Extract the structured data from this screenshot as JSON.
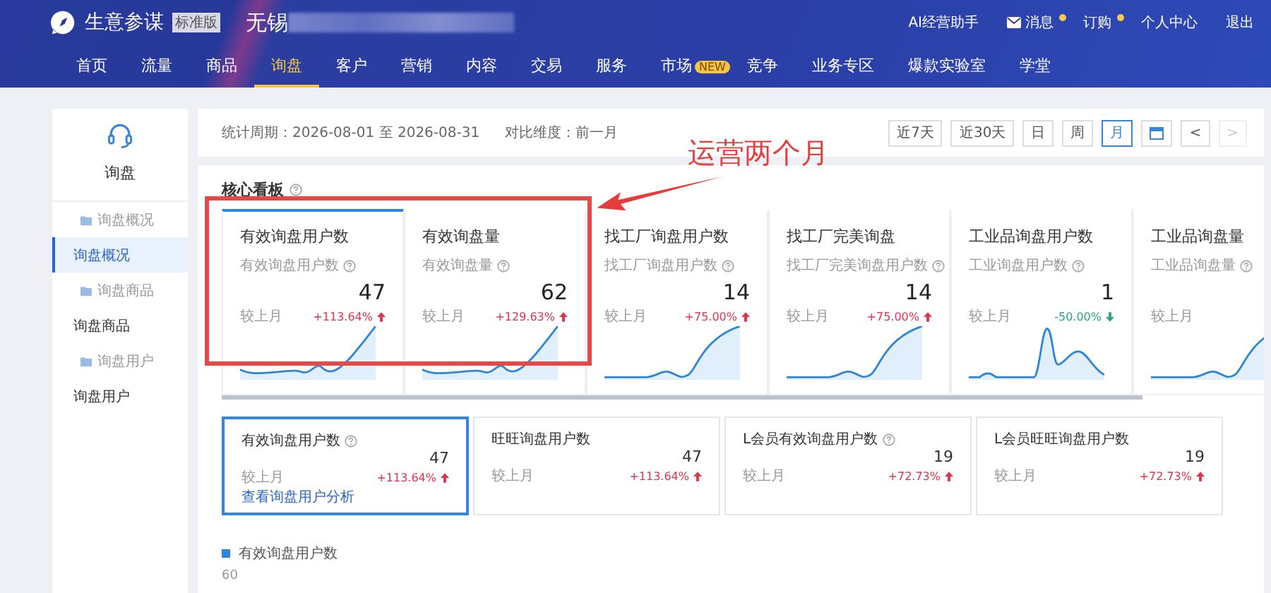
{
  "header": {
    "brand": "生意参谋",
    "edition": "标准版",
    "shop": "无锡",
    "links": [
      {
        "label": "AI经营助手",
        "icon": false,
        "dot": false
      },
      {
        "label": "消息",
        "icon": true,
        "dot": true
      },
      {
        "label": "订购",
        "icon": false,
        "dot": true
      },
      {
        "label": "个人中心",
        "icon": false,
        "dot": false
      },
      {
        "label": "退出",
        "icon": false,
        "dot": false
      }
    ]
  },
  "nav": [
    {
      "label": "首页",
      "selected": false
    },
    {
      "label": "流量",
      "selected": false
    },
    {
      "label": "商品",
      "selected": false
    },
    {
      "label": "询盘",
      "selected": true
    },
    {
      "label": "客户",
      "selected": false
    },
    {
      "label": "营销",
      "selected": false
    },
    {
      "label": "内容",
      "selected": false
    },
    {
      "label": "交易",
      "selected": false
    },
    {
      "label": "服务",
      "selected": false
    },
    {
      "label": "市场",
      "selected": false,
      "badge": "NEW"
    },
    {
      "label": "竞争",
      "selected": false
    },
    {
      "label": "业务专区",
      "selected": false
    },
    {
      "label": "爆款实验室",
      "selected": false
    },
    {
      "label": "学堂",
      "selected": false
    }
  ],
  "sidebar": {
    "title": "询盘",
    "items": [
      {
        "kind": "sub",
        "label": "询盘概况",
        "selected": false
      },
      {
        "kind": "main",
        "label": "询盘概况",
        "selected": true
      },
      {
        "kind": "sub",
        "label": "询盘商品",
        "selected": false
      },
      {
        "kind": "main",
        "label": "询盘商品",
        "selected": false
      },
      {
        "kind": "sub",
        "label": "询盘用户",
        "selected": false
      },
      {
        "kind": "main",
        "label": "询盘用户",
        "selected": false
      }
    ]
  },
  "filter": {
    "period_label": "统计周期：",
    "period": "2026-08-01 至 2026-08-31",
    "compare_label": "对比维度：",
    "compare": "前一月",
    "buttons": [
      {
        "kind": "text",
        "label": "近7天",
        "selected": false,
        "disabled": false
      },
      {
        "kind": "text",
        "label": "近30天",
        "selected": false,
        "disabled": false
      },
      {
        "kind": "text",
        "label": "日",
        "selected": false,
        "disabled": false
      },
      {
        "kind": "text",
        "label": "周",
        "selected": false,
        "disabled": false
      },
      {
        "kind": "text",
        "label": "月",
        "selected": true,
        "disabled": false
      },
      {
        "kind": "calendar",
        "selected": false,
        "disabled": false
      },
      {
        "kind": "text",
        "label": "<",
        "selected": false,
        "disabled": false
      },
      {
        "kind": "text",
        "label": ">",
        "selected": false,
        "disabled": true
      }
    ]
  },
  "annotation": {
    "text": "运营两个月"
  },
  "core_board": {
    "title": "核心看板",
    "cards": [
      {
        "title": "有效询盘用户数",
        "subtitle": "有效询盘用户数",
        "value": "47",
        "compare": "较上月",
        "delta": "+113.64%",
        "rising": true,
        "kind": "rise",
        "selected": true
      },
      {
        "title": "有效询盘量",
        "subtitle": "有效询盘量",
        "value": "62",
        "compare": "较上月",
        "delta": "+129.63%",
        "rising": true,
        "kind": "rise",
        "selected": false
      },
      {
        "title": "找工厂询盘用户数",
        "subtitle": "找工厂询盘用户数",
        "value": "14",
        "compare": "较上月",
        "delta": "+75.00%",
        "rising": true,
        "kind": "late",
        "selected": false
      },
      {
        "title": "找工厂完美询盘",
        "subtitle": "找工厂完美询盘用户数",
        "value": "14",
        "compare": "较上月",
        "delta": "+75.00%",
        "rising": true,
        "kind": "late",
        "selected": false
      },
      {
        "title": "工业品询盘用户数",
        "subtitle": "工业询盘用户数",
        "value": "1",
        "compare": "较上月",
        "delta": "-50.00%",
        "rising": false,
        "kind": "peak",
        "selected": false
      },
      {
        "title": "工业品询盘量",
        "subtitle": "工业品询盘量",
        "compare": "较上月",
        "kind": "late",
        "selected": false
      }
    ]
  },
  "detail_cards": [
    {
      "title": "有效询盘用户数",
      "help": true,
      "value": "47",
      "compare": "较上月",
      "delta": "+113.64%",
      "rising": true,
      "link": "查看询盘用户分析",
      "selected": true
    },
    {
      "title": "旺旺询盘用户数",
      "help": false,
      "value": "47",
      "compare": "较上月",
      "delta": "+113.64%",
      "rising": true,
      "selected": false
    },
    {
      "title": "L会员有效询盘用户数",
      "help": true,
      "value": "19",
      "compare": "较上月",
      "delta": "+72.73%",
      "rising": true,
      "selected": false
    },
    {
      "title": "L会员旺旺询盘用户数",
      "help": false,
      "value": "19",
      "compare": "较上月",
      "delta": "+72.73%",
      "rising": true,
      "selected": false
    }
  ],
  "chart": {
    "legend": "有效询盘用户数",
    "y_tick": "60"
  }
}
